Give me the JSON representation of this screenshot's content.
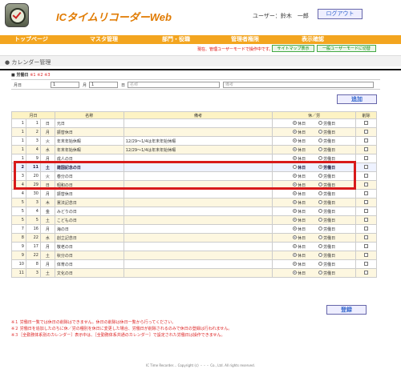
{
  "header": {
    "app_title": "ICタイムリコーダーWeb",
    "user_label": "ユーザー：鈴木　一郎",
    "logout_label": "ログアウト"
  },
  "nav": [
    {
      "label": "トップページ"
    },
    {
      "label": "マスタ管理"
    },
    {
      "label": "部門・役職"
    },
    {
      "label": "管理者権限"
    },
    {
      "label": "表示確認"
    }
  ],
  "subbar": {
    "mode_text": "現在、管理ユーザーモードで操作中です。",
    "sitemap_label": "サイトマップ表示",
    "general_user_label": "一般ユーザーモードに切替"
  },
  "section_title": "● カレンダー管理",
  "legend": {
    "label": "■ 労働日",
    "marks": "※1 ※2 ※3"
  },
  "form": {
    "label": "月日",
    "month_value": "1",
    "month_unit": "月",
    "day_value": "1",
    "day_unit": "日",
    "name_placeholder": "名称",
    "note_placeholder": "備考"
  },
  "add_button": "追加",
  "table": {
    "headers": {
      "date": "月日",
      "name": "名称",
      "note": "備考",
      "kind": "休／労",
      "delete": "削除"
    },
    "holiday_label": "休日",
    "workday_label": "労働日",
    "rows": [
      {
        "m": "1",
        "d": "1",
        "w": "日",
        "name": "元日",
        "note": "",
        "kind": "休日"
      },
      {
        "m": "1",
        "d": "2",
        "w": "月",
        "name": "振替休日",
        "note": "",
        "kind": "休日"
      },
      {
        "m": "1",
        "d": "3",
        "w": "火",
        "name": "年末年始休暇",
        "note": "12/29～1/4は年末年始休暇",
        "kind": "休日"
      },
      {
        "m": "1",
        "d": "4",
        "w": "水",
        "name": "年末年始休暇",
        "note": "12/29～1/4は年末年始休暇",
        "kind": "休日"
      },
      {
        "m": "1",
        "d": "9",
        "w": "月",
        "name": "成人の日",
        "note": "",
        "kind": "休日"
      },
      {
        "m": "2",
        "d": "11",
        "w": "土",
        "name": "建国記念の日",
        "note": "",
        "kind": "労働日"
      },
      {
        "m": "3",
        "d": "20",
        "w": "火",
        "name": "春分の日",
        "note": "",
        "kind": "休日"
      },
      {
        "m": "4",
        "d": "29",
        "w": "日",
        "name": "昭和の日",
        "note": "",
        "kind": "休日"
      },
      {
        "m": "4",
        "d": "30",
        "w": "月",
        "name": "振替休日",
        "note": "",
        "kind": "休日"
      },
      {
        "m": "5",
        "d": "3",
        "w": "木",
        "name": "憲法記念日",
        "note": "",
        "kind": "休日"
      },
      {
        "m": "5",
        "d": "4",
        "w": "金",
        "name": "みどりの日",
        "note": "",
        "kind": "休日"
      },
      {
        "m": "5",
        "d": "5",
        "w": "土",
        "name": "こどもの日",
        "note": "",
        "kind": "休日"
      },
      {
        "m": "7",
        "d": "16",
        "w": "月",
        "name": "海の日",
        "note": "",
        "kind": "休日"
      },
      {
        "m": "8",
        "d": "22",
        "w": "水",
        "name": "創立記念日",
        "note": "",
        "kind": "休日"
      },
      {
        "m": "9",
        "d": "17",
        "w": "月",
        "name": "敬老の日",
        "note": "",
        "kind": "休日"
      },
      {
        "m": "9",
        "d": "22",
        "w": "土",
        "name": "秋分の日",
        "note": "",
        "kind": "休日"
      },
      {
        "m": "10",
        "d": "8",
        "w": "月",
        "name": "体育の日",
        "note": "",
        "kind": "休日"
      },
      {
        "m": "11",
        "d": "3",
        "w": "土",
        "name": "文化の日",
        "note": "",
        "kind": "休日"
      }
    ]
  },
  "register_button": "登録",
  "notes": [
    "※１ 労働日一覧では休日の削除はできません。休日の削除は休日一覧から行ってください。",
    "※２ 労働日を追加したのちに休／労の種別を休日に変更した場合、労働日が削除されるのみで休日の登録は行われません。",
    "※３［全勤務体系別のカレンダー］表示中は、［全勤務体系共通のカレンダー］で設定された労働日は操作できません。"
  ],
  "footer": "IC Time Recorder… Copyright (c) ・・・ Co., Ltd. All rights reserved."
}
